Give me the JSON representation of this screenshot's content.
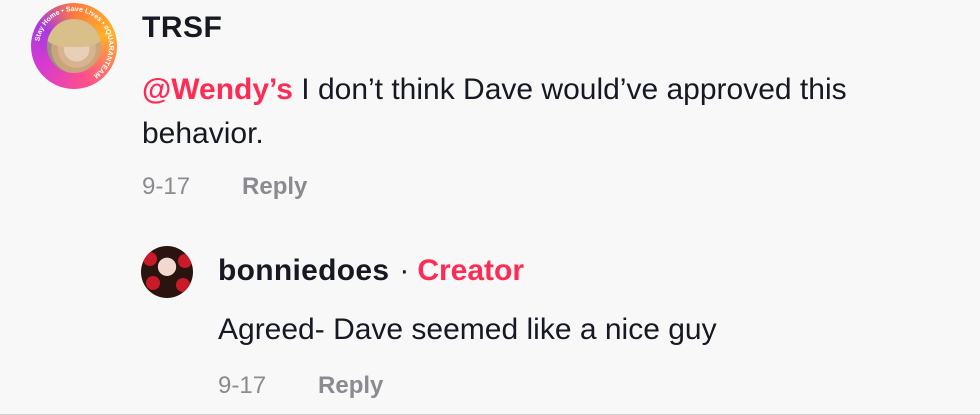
{
  "comment": {
    "username": "TRSF",
    "avatar_ring_text": "Stay Home • Save Lives • #QUARANTEAM",
    "mention": "@Wendy’s",
    "text": " I don’t think Dave would’ve approved this behavior.",
    "date": "9-17",
    "reply_label": "Reply"
  },
  "reply": {
    "username": "bonniedoes",
    "separator": "·",
    "badge": "Creator",
    "text": "Agreed- Dave seemed like a nice guy",
    "date": "9-17",
    "reply_label": "Reply"
  },
  "colors": {
    "accent": "#fe2c55",
    "meta": "#8a8b91",
    "text": "#161823",
    "background": "#f8f8f8"
  }
}
